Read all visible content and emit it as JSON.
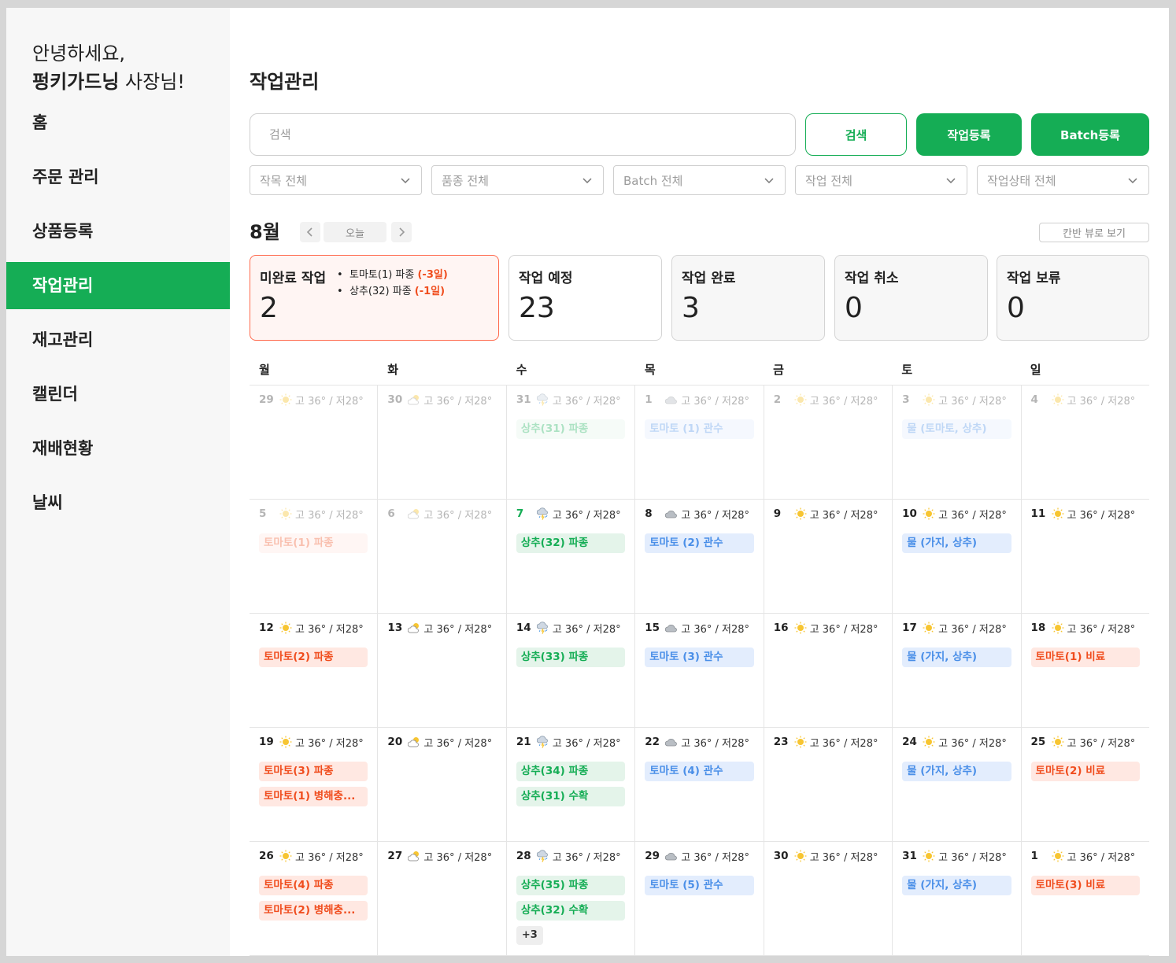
{
  "sidebar": {
    "greeting_line1": "안녕하세요,",
    "greeting_name": "펑키가드닝",
    "greeting_suffix": " 사장님!",
    "items": [
      {
        "label": "홈",
        "active": false
      },
      {
        "label": "주문 관리",
        "active": false
      },
      {
        "label": "상품등록",
        "active": false
      },
      {
        "label": "작업관리",
        "active": true
      },
      {
        "label": "재고관리",
        "active": false
      },
      {
        "label": "캘린더",
        "active": false
      },
      {
        "label": "재배현황",
        "active": false
      },
      {
        "label": "날씨",
        "active": false
      }
    ]
  },
  "header": {
    "title": "작업관리",
    "search_placeholder": "검색",
    "search_button": "검색",
    "register_button": "작업등록",
    "batch_button": "Batch등록"
  },
  "filters": [
    "작목 전체",
    "품종 전체",
    "Batch 전체",
    "작업 전체",
    "작업상태 전체"
  ],
  "calendar_nav": {
    "month": "8월",
    "today_label": "오늘",
    "kanban_label": "칸반 뷰로 보기"
  },
  "stats": {
    "incomplete": {
      "title": "미완료 작업",
      "count": "2",
      "items": [
        {
          "text": "토마토(1) 파종 ",
          "delay": "(-3일)"
        },
        {
          "text": "상추(32) 파종 ",
          "delay": "(-1일)"
        }
      ]
    },
    "scheduled": {
      "title": "작업 예정",
      "count": "23"
    },
    "done": {
      "title": "작업 완료",
      "count": "3"
    },
    "cancelled": {
      "title": "작업 취소",
      "count": "0"
    },
    "hold": {
      "title": "작업 보류",
      "count": "0"
    }
  },
  "colors": {
    "accent": "#15ad55",
    "alert": "#f04d1e",
    "blue": "#4a8fe8"
  },
  "weekdays": [
    "월",
    "화",
    "수",
    "목",
    "금",
    "토",
    "일"
  ],
  "temp_label": "고 36° / 저28°",
  "weather_by_col": [
    "sun-icon",
    "partly-cloudy-icon",
    "storm-icon",
    "cloud-icon",
    "sun-icon",
    "sun-icon",
    "sun-icon"
  ],
  "weeks": [
    [
      {
        "day": "29",
        "dim": true,
        "tasks": []
      },
      {
        "day": "30",
        "dim": true,
        "tasks": []
      },
      {
        "day": "31",
        "dim": true,
        "tasks": [
          {
            "label": "상추(31) 파종",
            "color": "green"
          }
        ]
      },
      {
        "day": "1",
        "dim": true,
        "tasks": [
          {
            "label": "토마토 (1) 관수",
            "color": "blue"
          }
        ]
      },
      {
        "day": "2",
        "dim": true,
        "tasks": []
      },
      {
        "day": "3",
        "dim": true,
        "tasks": [
          {
            "label": "물 (토마토, 상추)",
            "color": "blue"
          }
        ]
      },
      {
        "day": "4",
        "dim": true,
        "tasks": []
      }
    ],
    [
      {
        "day": "5",
        "dim": true,
        "tasks": [
          {
            "label": "토마토(1) 파종",
            "color": "red"
          }
        ]
      },
      {
        "day": "6",
        "dim": true,
        "tasks": []
      },
      {
        "day": "7",
        "today": true,
        "tasks": [
          {
            "label": "상추(32) 파종",
            "color": "green"
          }
        ]
      },
      {
        "day": "8",
        "tasks": [
          {
            "label": "토마토 (2) 관수",
            "color": "blue"
          }
        ]
      },
      {
        "day": "9",
        "tasks": []
      },
      {
        "day": "10",
        "tasks": [
          {
            "label": "물 (가지, 상추)",
            "color": "blue"
          }
        ]
      },
      {
        "day": "11",
        "tasks": []
      }
    ],
    [
      {
        "day": "12",
        "tasks": [
          {
            "label": "토마토(2) 파종",
            "color": "red"
          }
        ]
      },
      {
        "day": "13",
        "tasks": []
      },
      {
        "day": "14",
        "tasks": [
          {
            "label": "상추(33) 파종",
            "color": "green"
          }
        ]
      },
      {
        "day": "15",
        "tasks": [
          {
            "label": "토마토 (3) 관수",
            "color": "blue"
          }
        ]
      },
      {
        "day": "16",
        "tasks": []
      },
      {
        "day": "17",
        "tasks": [
          {
            "label": "물 (가지, 상추)",
            "color": "blue"
          }
        ]
      },
      {
        "day": "18",
        "tasks": [
          {
            "label": "토마토(1) 비료",
            "color": "red"
          }
        ]
      }
    ],
    [
      {
        "day": "19",
        "tasks": [
          {
            "label": "토마토(3) 파종",
            "color": "red"
          },
          {
            "label": "토마토(1) 병해충...",
            "color": "red"
          }
        ]
      },
      {
        "day": "20",
        "tasks": []
      },
      {
        "day": "21",
        "tasks": [
          {
            "label": "상추(34) 파종",
            "color": "green"
          },
          {
            "label": "상추(31) 수확",
            "color": "green"
          }
        ]
      },
      {
        "day": "22",
        "tasks": [
          {
            "label": "토마토 (4) 관수",
            "color": "blue"
          }
        ]
      },
      {
        "day": "23",
        "tasks": []
      },
      {
        "day": "24",
        "tasks": [
          {
            "label": "물 (가지, 상추)",
            "color": "blue"
          }
        ]
      },
      {
        "day": "25",
        "tasks": [
          {
            "label": "토마토(2) 비료",
            "color": "red"
          }
        ]
      }
    ],
    [
      {
        "day": "26",
        "tasks": [
          {
            "label": "토마토(4) 파종",
            "color": "red"
          },
          {
            "label": "토마토(2) 병해충...",
            "color": "red"
          }
        ]
      },
      {
        "day": "27",
        "tasks": []
      },
      {
        "day": "28",
        "tasks": [
          {
            "label": "상추(35) 파종",
            "color": "green"
          },
          {
            "label": "상추(32) 수확",
            "color": "green"
          }
        ],
        "more": "+3"
      },
      {
        "day": "29",
        "tasks": [
          {
            "label": "토마토 (5) 관수",
            "color": "blue"
          }
        ]
      },
      {
        "day": "30",
        "tasks": []
      },
      {
        "day": "31",
        "tasks": [
          {
            "label": "물 (가지, 상추)",
            "color": "blue"
          }
        ]
      },
      {
        "day": "1",
        "tasks": [
          {
            "label": "토마토(3) 비료",
            "color": "red"
          }
        ]
      }
    ]
  ]
}
